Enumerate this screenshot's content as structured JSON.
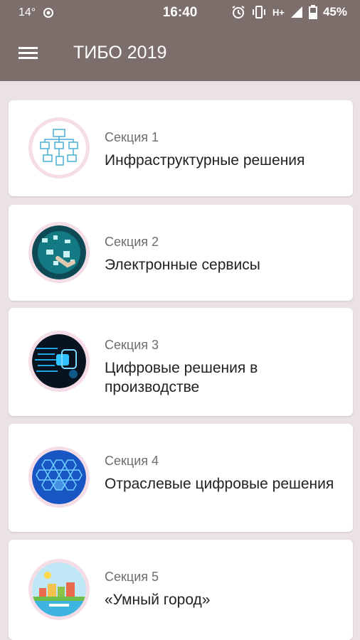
{
  "status_bar": {
    "temperature": "14°",
    "time": "16:40",
    "network": "H+",
    "battery": "45%"
  },
  "app_bar": {
    "title": "ТИБО 2019",
    "menu_icon": "hamburger-menu-icon"
  },
  "sections": [
    {
      "label": "Секция 1",
      "title": "Инфраструктурные решения",
      "image": "infrastructure-diagram-image"
    },
    {
      "label": "Секция 2",
      "title": "Электронные сервисы",
      "image": "electronic-services-image"
    },
    {
      "label": "Секция 3",
      "title": "Цифровые решения в производстве",
      "image": "digital-production-image"
    },
    {
      "label": "Секция 4",
      "title": "Отраслевые цифровые решения",
      "image": "industry-hexagons-image"
    },
    {
      "label": "Секция 5",
      "title": "«Умный город»",
      "image": "smart-city-image"
    }
  ],
  "colors": {
    "app_bar": "#7c6e6b",
    "background": "#eae2e4",
    "card": "#ffffff",
    "thumb_ring": "#f4dde6"
  }
}
